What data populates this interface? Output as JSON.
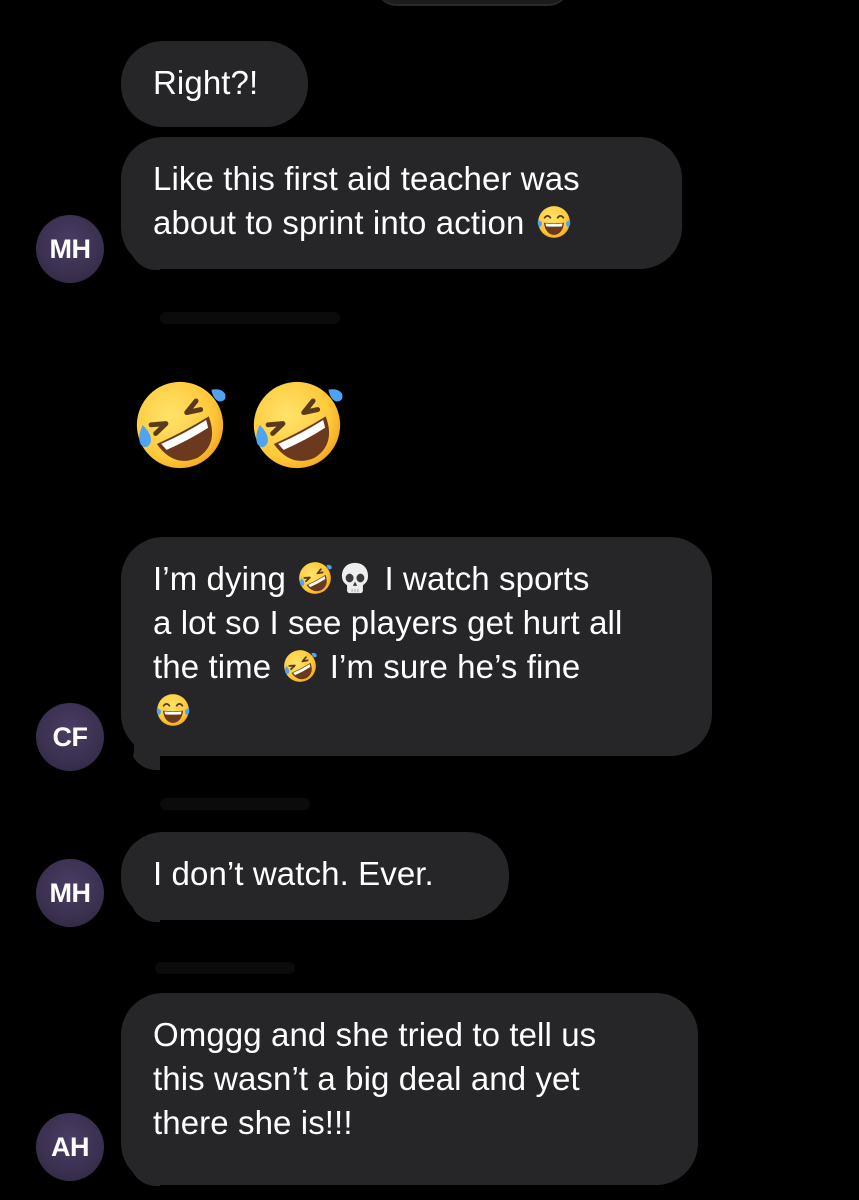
{
  "messages": [
    {
      "sender": "",
      "lines": [
        "Right?!"
      ]
    },
    {
      "sender": "MH",
      "lines": [
        "Like this first aid teacher was",
        "about to sprint into action"
      ]
    },
    {
      "sender": "",
      "emoji_only": true,
      "emoji_icons": [
        "rolling-on-floor-laughing-icon",
        "rolling-on-floor-laughing-icon"
      ]
    },
    {
      "sender": "CF",
      "lines": [
        "I’m dying",
        "I watch sports",
        "a lot so I see players get hurt all",
        "the time",
        "I’m sure he’s fine"
      ]
    },
    {
      "sender": "MH",
      "lines": [
        "I don’t watch. Ever."
      ]
    },
    {
      "sender": "AH",
      "lines": [
        "Omggg and she tried to tell us",
        "this wasn’t a big deal and yet",
        "there she is!!!"
      ]
    }
  ],
  "colors": {
    "background": "#000000",
    "bubble": "#262628",
    "text": "#ffffff",
    "avatar": "#3a304f"
  },
  "icons": [
    "face-with-tears-of-joy-icon",
    "rolling-on-floor-laughing-icon",
    "skull-icon"
  ]
}
